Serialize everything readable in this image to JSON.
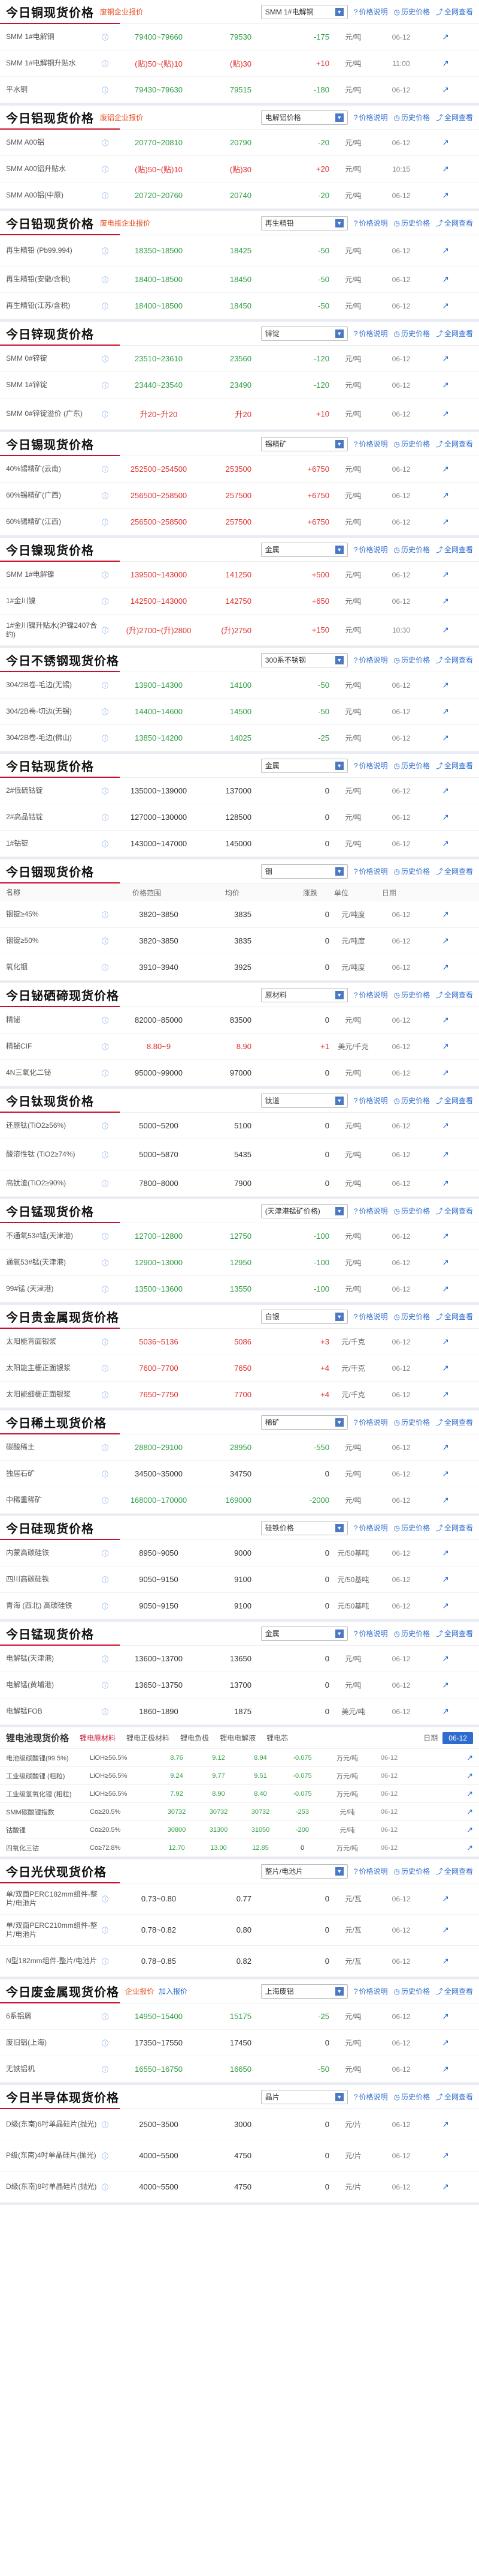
{
  "common": {
    "price_desc": "价格说明",
    "history": "历史价格",
    "fullnet": "全网查看",
    "trend_icon": "chart-line-icon",
    "col_name": "名称",
    "col_range": "价格范围",
    "col_avg": "均价",
    "col_chg": "涨跌",
    "col_unit": "单位",
    "col_date": "日期"
  },
  "sections": [
    {
      "title": "今日铜现货价格",
      "tag": "废铜企业报价",
      "select": "SMM 1#电解铜",
      "rows": [
        {
          "name": "SMM 1#电解铜",
          "range": "79400~79660",
          "avg": "79530",
          "chg": "-175",
          "unit": "元/吨",
          "date": "06-12"
        },
        {
          "name": "SMM 1#电解铜升贴水",
          "range": "(贴)50~(贴)10",
          "avg": "(贴)30",
          "chg": "+10",
          "unit": "元/吨",
          "date": "11:00"
        },
        {
          "name": "平水铜",
          "range": "79430~79630",
          "avg": "79515",
          "chg": "-180",
          "unit": "元/吨",
          "date": "06-12"
        }
      ]
    },
    {
      "title": "今日铝现货价格",
      "tag": "废铝企业报价",
      "select": "电解铝价格",
      "rows": [
        {
          "name": "SMM A00铝",
          "range": "20770~20810",
          "avg": "20790",
          "chg": "-20",
          "unit": "元/吨",
          "date": "06-12"
        },
        {
          "name": "SMM A00铝升贴水",
          "range": "(贴)50~(贴)10",
          "avg": "(贴)30",
          "chg": "+20",
          "unit": "元/吨",
          "date": "10:15"
        },
        {
          "name": "SMM A00铝(中原)",
          "range": "20720~20760",
          "avg": "20740",
          "chg": "-20",
          "unit": "元/吨",
          "date": "06-12"
        }
      ]
    },
    {
      "title": "今日铅现货价格",
      "tag": "废电瓶企业报价",
      "select": "再生精铅",
      "rows": [
        {
          "name": "再生精铅 (Pb99.994)",
          "range": "18350~18500",
          "avg": "18425",
          "chg": "-50",
          "unit": "元/吨",
          "date": "06-12"
        },
        {
          "name": "再生精铅(安徽/含税)",
          "range": "18400~18500",
          "avg": "18450",
          "chg": "-50",
          "unit": "元/吨",
          "date": "06-12"
        },
        {
          "name": "再生精铅(江苏/含税)",
          "range": "18400~18500",
          "avg": "18450",
          "chg": "-50",
          "unit": "元/吨",
          "date": "06-12"
        }
      ]
    },
    {
      "title": "今日锌现货价格",
      "tag": "",
      "select": "锌锭",
      "rows": [
        {
          "name": "SMM 0#锌锭",
          "range": "23510~23610",
          "avg": "23560",
          "chg": "-120",
          "unit": "元/吨",
          "date": "06-12"
        },
        {
          "name": "SMM 1#锌锭",
          "range": "23440~23540",
          "avg": "23490",
          "chg": "-120",
          "unit": "元/吨",
          "date": "06-12"
        },
        {
          "name": "SMM 0#锌锭溢价 (广东)",
          "range": "升20~升20",
          "avg": "升20",
          "chg": "+10",
          "unit": "元/吨",
          "date": "06-12"
        }
      ]
    },
    {
      "title": "今日锡现货价格",
      "tag": "",
      "select": "锡精矿",
      "rows": [
        {
          "name": "40%锡精矿(云南)",
          "range": "252500~254500",
          "avg": "253500",
          "chg": "+6750",
          "unit": "元/吨",
          "date": "06-12"
        },
        {
          "name": "60%锡精矿(广西)",
          "range": "256500~258500",
          "avg": "257500",
          "chg": "+6750",
          "unit": "元/吨",
          "date": "06-12"
        },
        {
          "name": "60%锡精矿(江西)",
          "range": "256500~258500",
          "avg": "257500",
          "chg": "+6750",
          "unit": "元/吨",
          "date": "06-12"
        }
      ]
    },
    {
      "title": "今日镍现货价格",
      "tag": "",
      "select": "金属",
      "rows": [
        {
          "name": "SMM 1#电解镍",
          "range": "139500~143000",
          "avg": "141250",
          "chg": "+500",
          "unit": "元/吨",
          "date": "06-12"
        },
        {
          "name": "1#金川镍",
          "range": "142500~143000",
          "avg": "142750",
          "chg": "+650",
          "unit": "元/吨",
          "date": "06-12"
        },
        {
          "name": "1#金川镍升贴水(沪镍2407合约)",
          "range": "(升)2700~(升)2800",
          "avg": "(升)2750",
          "chg": "+150",
          "unit": "元/吨",
          "date": "10:30"
        }
      ]
    },
    {
      "title": "今日不锈钢现货价格",
      "tag": "",
      "select": "300系不锈钢",
      "rows": [
        {
          "name": "304/2B卷-毛边(无锡)",
          "range": "13900~14300",
          "avg": "14100",
          "chg": "-50",
          "unit": "元/吨",
          "date": "06-12"
        },
        {
          "name": "304/2B卷-切边(无锡)",
          "range": "14400~14600",
          "avg": "14500",
          "chg": "-50",
          "unit": "元/吨",
          "date": "06-12"
        },
        {
          "name": "304/2B卷-毛边(佛山)",
          "range": "13850~14200",
          "avg": "14025",
          "chg": "-25",
          "unit": "元/吨",
          "date": "06-12"
        }
      ]
    },
    {
      "title": "今日钴现货价格",
      "tag": "",
      "select": "金属",
      "rows": [
        {
          "name": "2#低硫钴锭",
          "range": "135000~139000",
          "avg": "137000",
          "chg": "0",
          "unit": "元/吨",
          "date": "06-12"
        },
        {
          "name": "2#高品钴锭",
          "range": "127000~130000",
          "avg": "128500",
          "chg": "0",
          "unit": "元/吨",
          "date": "06-12"
        },
        {
          "name": "1#钴锭",
          "range": "143000~147000",
          "avg": "145000",
          "chg": "0",
          "unit": "元/吨",
          "date": "06-12"
        }
      ]
    },
    {
      "title": "今日铟现货价格",
      "tag": "",
      "select": "铟",
      "sub": "铟",
      "has_cols": true,
      "rows": [
        {
          "name": "铟锭≥45%",
          "range": "3820~3850",
          "avg": "3835",
          "chg": "0",
          "unit": "元/吨度",
          "date": "06-12"
        },
        {
          "name": "铟锭≥50%",
          "range": "3820~3850",
          "avg": "3835",
          "chg": "0",
          "unit": "元/吨度",
          "date": "06-12"
        },
        {
          "name": "氧化铟",
          "range": "3910~3940",
          "avg": "3925",
          "chg": "0",
          "unit": "元/吨度",
          "date": "06-12"
        }
      ]
    },
    {
      "title": "今日铋硒碲现货价格",
      "tag": "",
      "select": "原材料",
      "rows": [
        {
          "name": "精铋",
          "range": "82000~85000",
          "avg": "83500",
          "chg": "0",
          "unit": "元/吨",
          "date": "06-12"
        },
        {
          "name": "精铋CIF",
          "range": "8.80~9",
          "avg": "8.90",
          "chg": "+1",
          "unit": "美元/千克",
          "date": "06-12"
        },
        {
          "name": "4N三氧化二铋",
          "range": "95000~99000",
          "avg": "97000",
          "chg": "0",
          "unit": "元/吨",
          "date": "06-12"
        }
      ]
    },
    {
      "title": "今日钛现货价格",
      "tag": "",
      "select": "钛道",
      "rows": [
        {
          "name": "还原钛(TiO2≥56%)",
          "range": "5000~5200",
          "avg": "5100",
          "chg": "0",
          "unit": "元/吨",
          "date": "06-12"
        },
        {
          "name": "酸溶性钛 (TiO2≥74%)",
          "range": "5000~5870",
          "avg": "5435",
          "chg": "0",
          "unit": "元/吨",
          "date": "06-12"
        },
        {
          "name": "高钛渣(TiO2≥90%)",
          "range": "7800~8000",
          "avg": "7900",
          "chg": "0",
          "unit": "元/吨",
          "date": "06-12"
        }
      ]
    },
    {
      "title": "今日锰现货价格",
      "tag": "",
      "select": "(天津港锰矿价格)",
      "rows": [
        {
          "name": "不通氧53#锰(天津港)",
          "range": "12700~12800",
          "avg": "12750",
          "chg": "-100",
          "unit": "元/吨",
          "date": "06-12"
        },
        {
          "name": "通氧53#锰(天津港)",
          "range": "12900~13000",
          "avg": "12950",
          "chg": "-100",
          "unit": "元/吨",
          "date": "06-12"
        },
        {
          "name": "99#锰 (天津港)",
          "range": "13500~13600",
          "avg": "13550",
          "chg": "-100",
          "unit": "元/吨",
          "date": "06-12"
        }
      ]
    },
    {
      "title": "今日贵金属现货价格",
      "tag": "",
      "select": "白银",
      "rows": [
        {
          "name": "太阳能背面银浆",
          "range": "5036~5136",
          "avg": "5086",
          "chg": "+3",
          "unit": "元/千克",
          "date": "06-12"
        },
        {
          "name": "太阳能主栅正面银浆",
          "range": "7600~7700",
          "avg": "7650",
          "chg": "+4",
          "unit": "元/千克",
          "date": "06-12"
        },
        {
          "name": "太阳能细栅正面银浆",
          "range": "7650~7750",
          "avg": "7700",
          "chg": "+4",
          "unit": "元/千克",
          "date": "06-12"
        }
      ]
    },
    {
      "title": "今日稀土现货价格",
      "tag": "",
      "select": "稀矿",
      "rows": [
        {
          "name": "碳酸稀土",
          "range": "28800~29100",
          "avg": "28950",
          "chg": "-550",
          "unit": "元/吨",
          "date": "06-12"
        },
        {
          "name": "独居石矿",
          "range": "34500~35000",
          "avg": "34750",
          "chg": "0",
          "unit": "元/吨",
          "date": "06-12"
        },
        {
          "name": "中稀重稀矿",
          "range": "168000~170000",
          "avg": "169000",
          "chg": "-2000",
          "unit": "元/吨",
          "date": "06-12"
        }
      ]
    },
    {
      "title": "今日硅现货价格",
      "tag": "",
      "select": "硅铁价格",
      "rows": [
        {
          "name": "内蒙高碳硅铁",
          "range": "8950~9050",
          "avg": "9000",
          "chg": "0",
          "unit": "元/50基吨",
          "date": "06-12"
        },
        {
          "name": "四川高碳硅铁",
          "range": "9050~9150",
          "avg": "9100",
          "chg": "0",
          "unit": "元/50基吨",
          "date": "06-12"
        },
        {
          "name": "青海 (西北) 高碳硅铁",
          "range": "9050~9150",
          "avg": "9100",
          "chg": "0",
          "unit": "元/50基吨",
          "date": "06-12"
        }
      ]
    },
    {
      "title": "今日锰现货价格",
      "tag": "",
      "select": "金属",
      "rows": [
        {
          "name": "电解锰(天津港)",
          "range": "13600~13700",
          "avg": "13650",
          "chg": "0",
          "unit": "元/吨",
          "date": "06-12"
        },
        {
          "name": "电解锰(黄埔港)",
          "range": "13650~13750",
          "avg": "13700",
          "chg": "0",
          "unit": "元/吨",
          "date": "06-12"
        },
        {
          "name": "电解锰FOB",
          "range": "1860~1890",
          "avg": "1875",
          "chg": "0",
          "unit": "美元/吨",
          "date": "06-12"
        }
      ]
    }
  ],
  "lithium": {
    "title": "锂电池现货价格",
    "tabs": [
      "锂电原材料",
      "锂电正极材料",
      "锂电负极",
      "锂电电解液",
      "锂电芯"
    ],
    "date_label": "日期",
    "date_btn": "06-12",
    "rows": [
      {
        "name": "电池级碳酸锂(99.5%)",
        "spec": "LiOH≥56.5%",
        "a": "8.76",
        "b": "9.12",
        "c": "8.94",
        "d": "-0.075",
        "unit": "万元/吨",
        "date": "06-12"
      },
      {
        "name": "工业级碳酸锂 (粗粒)",
        "spec": "LiOH≥56.5%",
        "a": "9.24",
        "b": "9.77",
        "c": "9.51",
        "d": "-0.075",
        "unit": "万元/吨",
        "date": "06-12"
      },
      {
        "name": "工业级氢氧化锂 (粗粒)",
        "spec": "LiOH≥56.5%",
        "a": "7.92",
        "b": "8.90",
        "c": "8.40",
        "d": "-0.075",
        "unit": "万元/吨",
        "date": "06-12"
      },
      {
        "name": "SMM碳酸锂指数",
        "spec": "Co≥20.5%",
        "a": "30732",
        "b": "30732",
        "c": "30732",
        "d": "-253",
        "unit": "元/吨",
        "date": "06-12"
      },
      {
        "name": "钴酸锂",
        "spec": "Co≥20.5%",
        "a": "30800",
        "b": "31300",
        "c": "31050",
        "d": "-200",
        "unit": "元/吨",
        "date": "06-12"
      },
      {
        "name": "四氧化三钴",
        "spec": "Co≥72.8%",
        "a": "12.70",
        "b": "13.00",
        "c": "12.85",
        "d": "0",
        "unit": "万元/吨",
        "date": "06-12"
      }
    ]
  },
  "sections2": [
    {
      "title": "今日光伏现货价格",
      "tag": "",
      "select": "整片/电池片",
      "rows": [
        {
          "name": "单/双面PERC182mm组件-整片/电池片",
          "range": "0.73~0.80",
          "avg": "0.77",
          "chg": "0",
          "unit": "元/瓦",
          "date": "06-12"
        },
        {
          "name": "单/双面PERC210mm组件-整片/电池片",
          "range": "0.78~0.82",
          "avg": "0.80",
          "chg": "0",
          "unit": "元/瓦",
          "date": "06-12"
        },
        {
          "name": "N型182mm组件-整片/电池片",
          "range": "0.78~0.85",
          "avg": "0.82",
          "chg": "0",
          "unit": "元/瓦",
          "date": "06-12"
        }
      ]
    },
    {
      "title": "今日废金属现货价格",
      "tag": "企业报价",
      "select": "上海废铝",
      "link": "加入报价",
      "rows": [
        {
          "name": "6系铝屑",
          "range": "14950~15400",
          "avg": "15175",
          "chg": "-25",
          "unit": "元/吨",
          "date": "06-12"
        },
        {
          "name": "废旧铝(上海)",
          "range": "17350~17550",
          "avg": "17450",
          "chg": "0",
          "unit": "元/吨",
          "date": "06-12"
        },
        {
          "name": "无铁铝机",
          "range": "16550~16750",
          "avg": "16650",
          "chg": "-50",
          "unit": "元/吨",
          "date": "06-12"
        }
      ]
    },
    {
      "title": "今日半导体现货价格",
      "tag": "",
      "select": "晶片",
      "rows": [
        {
          "name": "D级(东南)6吋单晶硅片(抛光)",
          "range": "2500~3500",
          "avg": "3000",
          "chg": "0",
          "unit": "元/片",
          "date": "06-12"
        },
        {
          "name": "P级(东南)4吋单晶硅片(抛光)",
          "range": "4000~5500",
          "avg": "4750",
          "chg": "0",
          "unit": "元/片",
          "date": "06-12"
        },
        {
          "name": "D级(东南)8吋单晶硅片(抛光)",
          "range": "4000~5500",
          "avg": "4750",
          "chg": "0",
          "unit": "元/片",
          "date": "06-12"
        }
      ]
    }
  ]
}
